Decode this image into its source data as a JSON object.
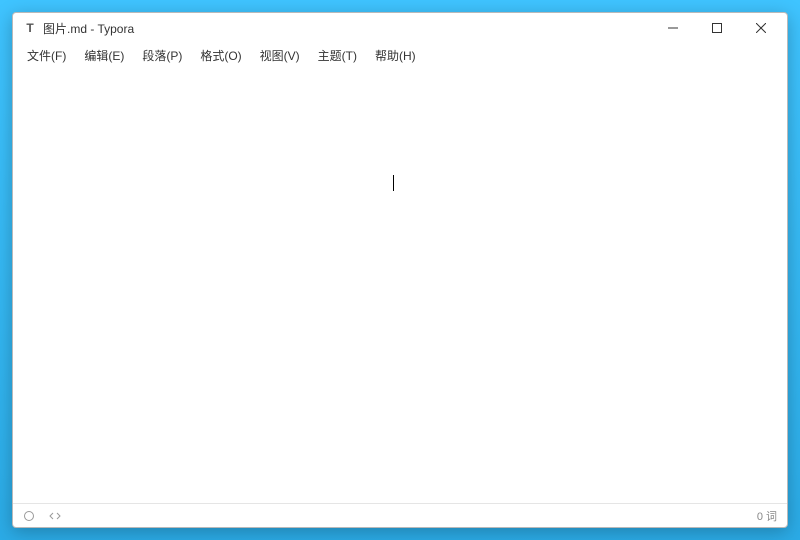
{
  "window": {
    "app_icon_letter": "T",
    "title": "图片.md - Typora"
  },
  "menubar": {
    "items": [
      {
        "label": "文件(F)"
      },
      {
        "label": "编辑(E)"
      },
      {
        "label": "段落(P)"
      },
      {
        "label": "格式(O)"
      },
      {
        "label": "视图(V)"
      },
      {
        "label": "主题(T)"
      },
      {
        "label": "帮助(H)"
      }
    ]
  },
  "statusbar": {
    "word_count": "0 词"
  }
}
